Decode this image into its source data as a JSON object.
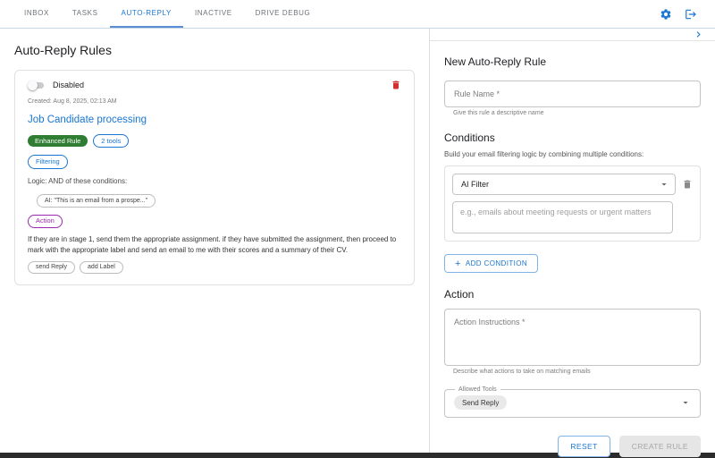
{
  "colors": {
    "accent": "#1976d2",
    "success_green": "#2e7d32",
    "purple": "#9c27b0",
    "danger_red": "#d32f2f"
  },
  "topbar": {
    "tabs": [
      {
        "label": "INBOX"
      },
      {
        "label": "TASKS"
      },
      {
        "label": "AUTO-REPLY"
      },
      {
        "label": "INACTIVE"
      },
      {
        "label": "DRIVE DEBUG"
      }
    ],
    "active_tab": "AUTO-REPLY",
    "icons": [
      "settings-gear",
      "logout"
    ]
  },
  "rules_panel": {
    "title": "Auto-Reply Rules",
    "rule_card": {
      "toggle_label": "Disabled",
      "toggle_state": "off",
      "created": "Created: Aug 8, 2025, 02:13 AM",
      "name": "Job Candidate processing",
      "badges": [
        {
          "label": "Enhanced Rule",
          "style": "green-filled"
        },
        {
          "label": "2 tools",
          "style": "blue-outlined"
        }
      ],
      "filtering_section_label": "Filtering",
      "logic_text": "Logic: AND of these conditions:",
      "condition_chip": "AI: \"This is an email from a prospe...\"",
      "action_section_label": "Action",
      "action_text": "If they are in stage 1, send them the appropriate assignment. if they have submitted the assignment, then proceed to mark with the appropriate label and send an email to me with their scores and a summary of their CV.",
      "tool_chips": [
        {
          "label": "send Reply"
        },
        {
          "label": "add Label"
        }
      ]
    }
  },
  "form_panel": {
    "title": "New Auto-Reply Rule",
    "rule_name": {
      "placeholder": "Rule Name *",
      "value": "",
      "helper": "Give this rule a descriptive name"
    },
    "conditions": {
      "title": "Conditions",
      "caption": "Build your email filtering logic by combining multiple conditions:",
      "type_selected": "AI Filter",
      "value_placeholder": "e.g., emails about meeting requests or urgent matters",
      "value": "",
      "add_button_label": "ADD CONDITION",
      "add_button_plus": "+"
    },
    "action": {
      "title": "Action",
      "instructions_placeholder": "Action Instructions *",
      "instructions_value": "",
      "helper": "Describe what actions to take on matching emails",
      "allowed_tools_label": "Allowed Tools",
      "allowed_tools_selected": "Send Reply"
    },
    "buttons": {
      "reset": "RESET",
      "create": "CREATE RULE"
    }
  }
}
